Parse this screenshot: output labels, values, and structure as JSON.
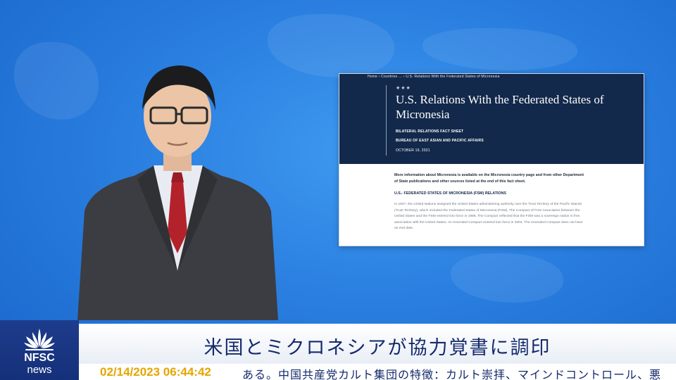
{
  "document": {
    "breadcrumb": "Home › Countries … › U.S. Relations With the Federated States of Micronesia",
    "stars": "★★★",
    "title": "U.S. Relations With the Federated States of Micronesia",
    "fact_sheet_label": "BILATERAL RELATIONS FACT SHEET",
    "bureau": "BUREAU OF EAST ASIAN AND PACIFIC AFFAIRS",
    "date": "OCTOBER 19, 2021",
    "intro": "More information about Micronesia is available on the Micronesia country page and from other Department of State publications and other sources listed at the end of this fact sheet.",
    "subheading": "U.S.- FEDERATED STATES OF MICRONESIA (FSM) RELATIONS",
    "paragraph": "In 1947, the United Nations assigned the United States administering authority over the Trust Territory of the Pacific Islands (Trust Territory), which included the Federated States of Micronesia (FSM). The Compact of Free Association between the United States and the FSM entered into force in 1986. The Compact reflected that the FSM was a sovereign nation in free association with the United States. An Amended Compact entered into force in 2004. The Amended Compact does not have an end date."
  },
  "logo": {
    "line1": "NFSC",
    "line2": "news"
  },
  "headline": "米国とミクロネシアが協力覚書に調印",
  "ticker": {
    "timestamp": "02/14/2023 06:44:42",
    "text": "ある。中国共産党カルト集団の特徴：カルト崇拝、マインドコントロール、悪"
  }
}
